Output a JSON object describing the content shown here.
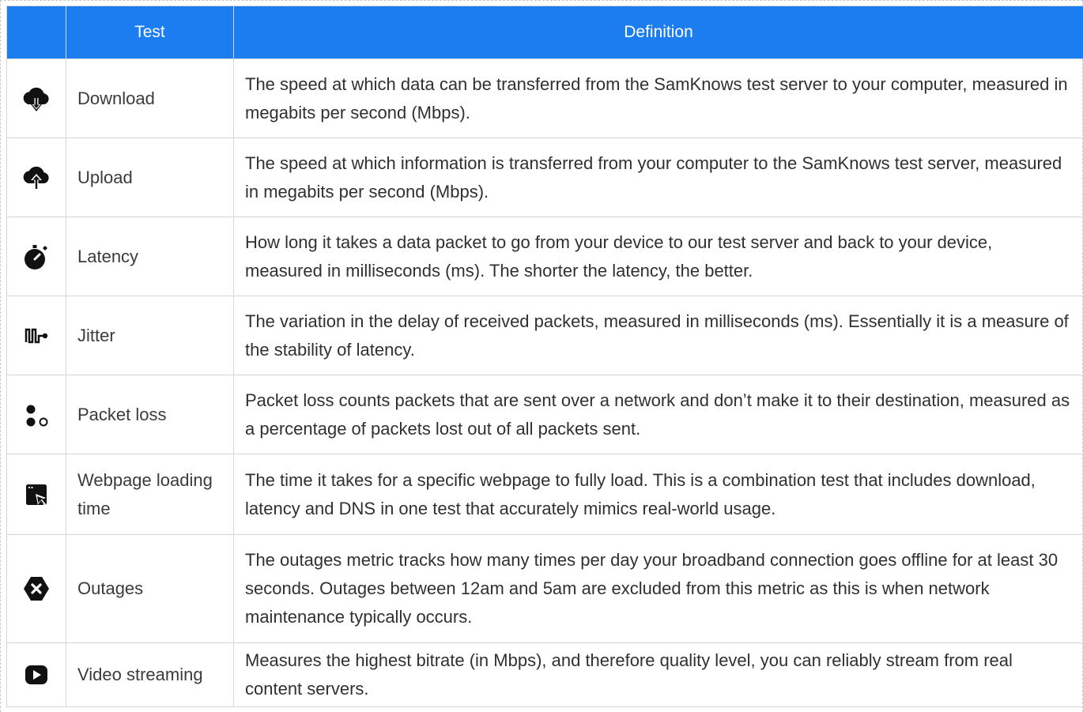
{
  "table": {
    "headers": {
      "icon": "",
      "test": "Test",
      "definition": "Definition"
    },
    "header_color": "#1b7df0",
    "rows": [
      {
        "icon": "cloud-download-icon",
        "test": "Download",
        "definition": "The speed at which data can be transferred from the SamKnows test server to your computer, measured in megabits per second (Mbps)."
      },
      {
        "icon": "cloud-upload-icon",
        "test": "Upload",
        "definition": "The speed at which information is transferred from your computer to the SamKnows test server, measured in megabits per second (Mbps)."
      },
      {
        "icon": "stopwatch-icon",
        "test": "Latency",
        "definition": "How long it takes a data packet to go from your device to our test server and back to your device, measured in milliseconds (ms). The shorter the latency, the better."
      },
      {
        "icon": "jitter-wave-icon",
        "test": "Jitter",
        "definition": "The variation in the delay of received packets, measured in milliseconds (ms). Essentially it is a measure of the stability of latency."
      },
      {
        "icon": "packet-dots-icon",
        "test": "Packet loss",
        "definition": "Packet loss counts packets that are sent over a network and don’t make it to their destination, measured as a percentage of packets lost out of all packets sent."
      },
      {
        "icon": "browser-cursor-icon",
        "test": "Webpage loading time",
        "definition": "The time it takes for a specific webpage to fully load. This is a combination test that includes download, latency and DNS in one test that accurately mimics real-world usage."
      },
      {
        "icon": "hexagon-x-icon",
        "test": "Outages",
        "definition": "The outages metric tracks how many times per day your broadband connection goes offline for at least 30 seconds. Outages between 12am and 5am are excluded from this metric as this is when network maintenance typically occurs."
      },
      {
        "icon": "play-button-icon",
        "test": "Video streaming",
        "definition": "Measures the highest bitrate (in Mbps), and therefore quality level, you can reliably stream from real content servers."
      }
    ]
  }
}
